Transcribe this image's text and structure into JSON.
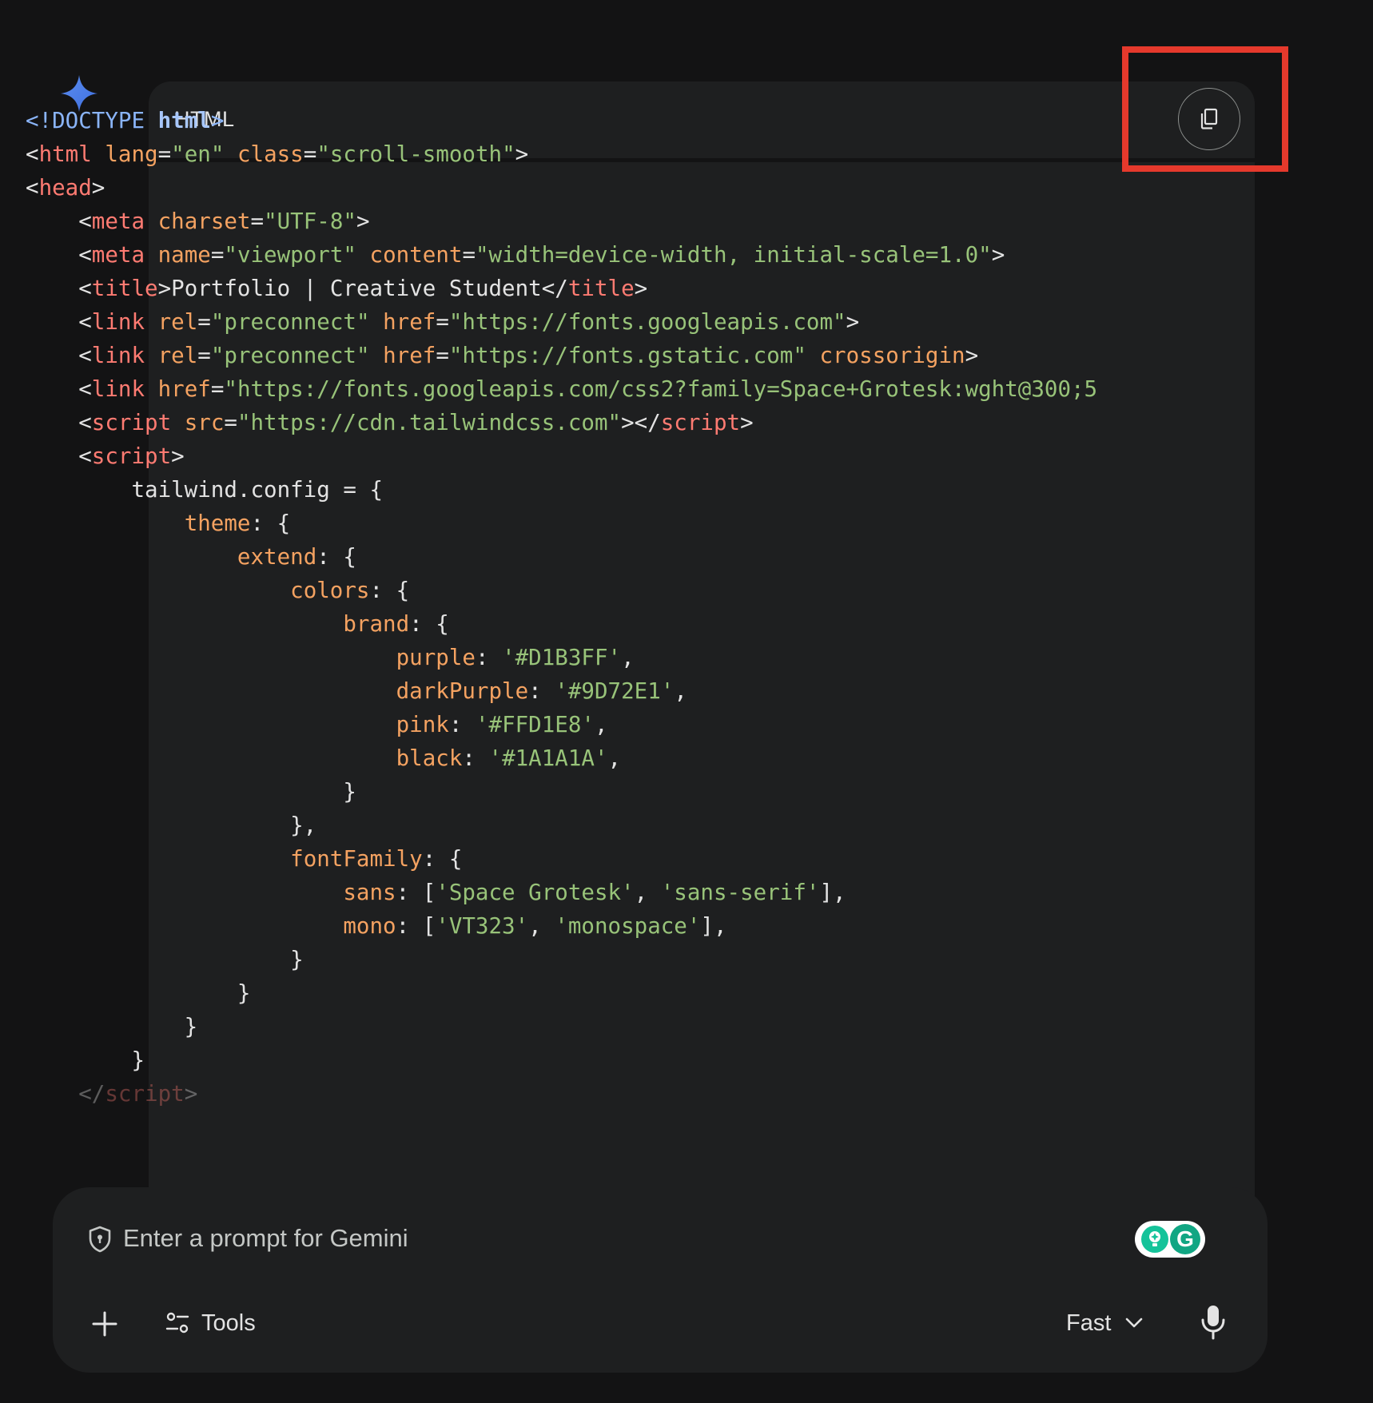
{
  "code_block": {
    "language": "HTML",
    "copy_button_label": "Copy code"
  },
  "code_lines": [
    [
      {
        "c": "t-doc",
        "t": "<!DOCTYPE "
      },
      {
        "c": "t-docb",
        "t": "html"
      },
      {
        "c": "t-doc",
        "t": ">"
      }
    ],
    [
      {
        "c": "t-txt",
        "t": "<"
      },
      {
        "c": "t-tag",
        "t": "html"
      },
      {
        "c": "t-txt",
        "t": " "
      },
      {
        "c": "t-attr",
        "t": "lang"
      },
      {
        "c": "t-txt",
        "t": "="
      },
      {
        "c": "t-str",
        "t": "\"en\""
      },
      {
        "c": "t-txt",
        "t": " "
      },
      {
        "c": "t-attr",
        "t": "class"
      },
      {
        "c": "t-txt",
        "t": "="
      },
      {
        "c": "t-str",
        "t": "\"scroll-smooth\""
      },
      {
        "c": "t-txt",
        "t": ">"
      }
    ],
    [
      {
        "c": "t-txt",
        "t": "<"
      },
      {
        "c": "t-tag",
        "t": "head"
      },
      {
        "c": "t-txt",
        "t": ">"
      }
    ],
    [
      {
        "c": "t-txt",
        "t": "    <"
      },
      {
        "c": "t-tag",
        "t": "meta"
      },
      {
        "c": "t-txt",
        "t": " "
      },
      {
        "c": "t-attr",
        "t": "charset"
      },
      {
        "c": "t-txt",
        "t": "="
      },
      {
        "c": "t-str",
        "t": "\"UTF-8\""
      },
      {
        "c": "t-txt",
        "t": ">"
      }
    ],
    [
      {
        "c": "t-txt",
        "t": "    <"
      },
      {
        "c": "t-tag",
        "t": "meta"
      },
      {
        "c": "t-txt",
        "t": " "
      },
      {
        "c": "t-attr",
        "t": "name"
      },
      {
        "c": "t-txt",
        "t": "="
      },
      {
        "c": "t-str",
        "t": "\"viewport\""
      },
      {
        "c": "t-txt",
        "t": " "
      },
      {
        "c": "t-attr",
        "t": "content"
      },
      {
        "c": "t-txt",
        "t": "="
      },
      {
        "c": "t-str",
        "t": "\"width=device-width, initial-scale=1.0\""
      },
      {
        "c": "t-txt",
        "t": ">"
      }
    ],
    [
      {
        "c": "t-txt",
        "t": "    <"
      },
      {
        "c": "t-tag",
        "t": "title"
      },
      {
        "c": "t-txt",
        "t": ">Portfolio | Creative Student</"
      },
      {
        "c": "t-tag",
        "t": "title"
      },
      {
        "c": "t-txt",
        "t": ">"
      }
    ],
    [
      {
        "c": "t-txt",
        "t": "    <"
      },
      {
        "c": "t-tag",
        "t": "link"
      },
      {
        "c": "t-txt",
        "t": " "
      },
      {
        "c": "t-attr",
        "t": "rel"
      },
      {
        "c": "t-txt",
        "t": "="
      },
      {
        "c": "t-str",
        "t": "\"preconnect\""
      },
      {
        "c": "t-txt",
        "t": " "
      },
      {
        "c": "t-attr",
        "t": "href"
      },
      {
        "c": "t-txt",
        "t": "="
      },
      {
        "c": "t-str",
        "t": "\"https://fonts.googleapis.com\""
      },
      {
        "c": "t-txt",
        "t": ">"
      }
    ],
    [
      {
        "c": "t-txt",
        "t": "    <"
      },
      {
        "c": "t-tag",
        "t": "link"
      },
      {
        "c": "t-txt",
        "t": " "
      },
      {
        "c": "t-attr",
        "t": "rel"
      },
      {
        "c": "t-txt",
        "t": "="
      },
      {
        "c": "t-str",
        "t": "\"preconnect\""
      },
      {
        "c": "t-txt",
        "t": " "
      },
      {
        "c": "t-attr",
        "t": "href"
      },
      {
        "c": "t-txt",
        "t": "="
      },
      {
        "c": "t-str",
        "t": "\"https://fonts.gstatic.com\""
      },
      {
        "c": "t-txt",
        "t": " "
      },
      {
        "c": "t-attr",
        "t": "crossorigin"
      },
      {
        "c": "t-txt",
        "t": ">"
      }
    ],
    [
      {
        "c": "t-txt",
        "t": "    <"
      },
      {
        "c": "t-tag",
        "t": "link"
      },
      {
        "c": "t-txt",
        "t": " "
      },
      {
        "c": "t-attr",
        "t": "href"
      },
      {
        "c": "t-txt",
        "t": "="
      },
      {
        "c": "t-str",
        "t": "\"https://fonts.googleapis.com/css2?family=Space+Grotesk:wght@300;5"
      }
    ],
    [
      {
        "c": "t-txt",
        "t": "    <"
      },
      {
        "c": "t-tag",
        "t": "script"
      },
      {
        "c": "t-txt",
        "t": " "
      },
      {
        "c": "t-attr",
        "t": "src"
      },
      {
        "c": "t-txt",
        "t": "="
      },
      {
        "c": "t-str",
        "t": "\"https://cdn.tailwindcss.com\""
      },
      {
        "c": "t-txt",
        "t": "></"
      },
      {
        "c": "t-tag",
        "t": "script"
      },
      {
        "c": "t-txt",
        "t": ">"
      }
    ],
    [
      {
        "c": "t-txt",
        "t": "    <"
      },
      {
        "c": "t-tag",
        "t": "script"
      },
      {
        "c": "t-txt",
        "t": ">"
      }
    ],
    [
      {
        "c": "t-txt",
        "t": "        tailwind.config = {"
      }
    ],
    [
      {
        "c": "t-txt",
        "t": "            "
      },
      {
        "c": "t-key",
        "t": "theme"
      },
      {
        "c": "t-txt",
        "t": ": {"
      }
    ],
    [
      {
        "c": "t-txt",
        "t": "                "
      },
      {
        "c": "t-key",
        "t": "extend"
      },
      {
        "c": "t-txt",
        "t": ": {"
      }
    ],
    [
      {
        "c": "t-txt",
        "t": "                    "
      },
      {
        "c": "t-key",
        "t": "colors"
      },
      {
        "c": "t-txt",
        "t": ": {"
      }
    ],
    [
      {
        "c": "t-txt",
        "t": "                        "
      },
      {
        "c": "t-key",
        "t": "brand"
      },
      {
        "c": "t-txt",
        "t": ": {"
      }
    ],
    [
      {
        "c": "t-txt",
        "t": "                            "
      },
      {
        "c": "t-key",
        "t": "purple"
      },
      {
        "c": "t-txt",
        "t": ": "
      },
      {
        "c": "t-str",
        "t": "'#D1B3FF'"
      },
      {
        "c": "t-txt",
        "t": ","
      }
    ],
    [
      {
        "c": "t-txt",
        "t": "                            "
      },
      {
        "c": "t-key",
        "t": "darkPurple"
      },
      {
        "c": "t-txt",
        "t": ": "
      },
      {
        "c": "t-str",
        "t": "'#9D72E1'"
      },
      {
        "c": "t-txt",
        "t": ","
      }
    ],
    [
      {
        "c": "t-txt",
        "t": "                            "
      },
      {
        "c": "t-key",
        "t": "pink"
      },
      {
        "c": "t-txt",
        "t": ": "
      },
      {
        "c": "t-str",
        "t": "'#FFD1E8'"
      },
      {
        "c": "t-txt",
        "t": ","
      }
    ],
    [
      {
        "c": "t-txt",
        "t": "                            "
      },
      {
        "c": "t-key",
        "t": "black"
      },
      {
        "c": "t-txt",
        "t": ": "
      },
      {
        "c": "t-str",
        "t": "'#1A1A1A'"
      },
      {
        "c": "t-txt",
        "t": ","
      }
    ],
    [
      {
        "c": "t-txt",
        "t": "                        }"
      }
    ],
    [
      {
        "c": "t-txt",
        "t": "                    },"
      }
    ],
    [
      {
        "c": "t-txt",
        "t": "                    "
      },
      {
        "c": "t-key",
        "t": "fontFamily"
      },
      {
        "c": "t-txt",
        "t": ": {"
      }
    ],
    [
      {
        "c": "t-txt",
        "t": "                        "
      },
      {
        "c": "t-key",
        "t": "sans"
      },
      {
        "c": "t-txt",
        "t": ": ["
      },
      {
        "c": "t-str",
        "t": "'Space Grotesk'"
      },
      {
        "c": "t-txt",
        "t": ", "
      },
      {
        "c": "t-str",
        "t": "'sans-serif'"
      },
      {
        "c": "t-txt",
        "t": "],"
      }
    ],
    [
      {
        "c": "t-txt",
        "t": "                        "
      },
      {
        "c": "t-key",
        "t": "mono"
      },
      {
        "c": "t-txt",
        "t": ": ["
      },
      {
        "c": "t-str",
        "t": "'VT323'"
      },
      {
        "c": "t-txt",
        "t": ", "
      },
      {
        "c": "t-str",
        "t": "'monospace'"
      },
      {
        "c": "t-txt",
        "t": "],"
      }
    ],
    [
      {
        "c": "t-txt",
        "t": "                    }"
      }
    ],
    [
      {
        "c": "t-txt",
        "t": "                }"
      }
    ],
    [
      {
        "c": "t-txt",
        "t": "            }"
      }
    ],
    [
      {
        "c": "t-txt",
        "t": "        }"
      }
    ],
    [
      {
        "c": "t-txt",
        "t": "    </"
      },
      {
        "c": "t-tag",
        "t": "script"
      },
      {
        "c": "t-txt",
        "t": ">"
      }
    ]
  ],
  "input": {
    "placeholder": "Enter a prompt for Gemini",
    "tools_label": "Tools",
    "mode_label": "Fast"
  },
  "colors": {
    "background": "#131314",
    "surface": "#1e1f20",
    "highlight": "#e5392c",
    "spark": "#4285f4"
  }
}
